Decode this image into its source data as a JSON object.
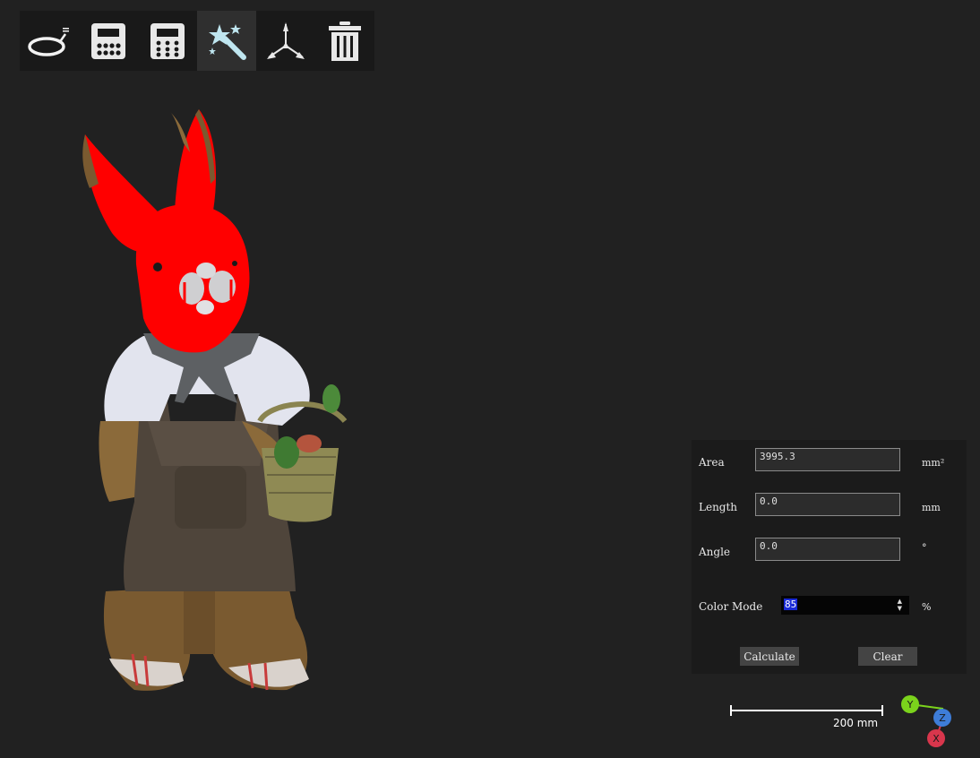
{
  "toolbar": {
    "tools": [
      {
        "icon": "lasso-select-icon"
      },
      {
        "icon": "calculator-icon"
      },
      {
        "icon": "keypad-icon"
      },
      {
        "icon": "magic-wand-icon",
        "active": true
      },
      {
        "icon": "axis-tripod-icon"
      },
      {
        "icon": "trash-icon"
      }
    ]
  },
  "viewport": {
    "model": "rabbit-figurine-scan",
    "highlight_color": "#ff0000"
  },
  "panel": {
    "area_label": "Area",
    "area_value": "3995.3",
    "area_unit": "mm²",
    "length_label": "Length",
    "length_value": "0.0",
    "length_unit": "mm",
    "angle_label": "Angle",
    "angle_value": "0.0",
    "angle_unit": "°",
    "color_mode_label": "Color Mode",
    "color_mode_value": "85",
    "color_mode_unit": "%",
    "calculate_label": "Calculate",
    "clear_label": "Clear"
  },
  "scale": {
    "label": "200 mm"
  },
  "axes": {
    "y": "Y",
    "z": "Z",
    "x": "X",
    "y_color": "#7bd31c",
    "z_color": "#3e7dd8",
    "x_color": "#d8364c"
  }
}
